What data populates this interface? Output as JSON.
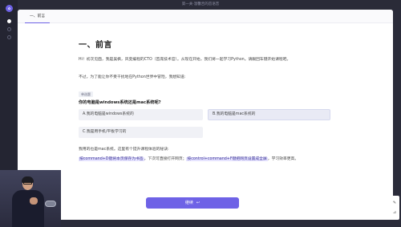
{
  "window": {
    "title": "第一关·温馨舌的首语音"
  },
  "rail": {
    "logo": "✿"
  },
  "tabs": [
    {
      "label": "一、前言"
    }
  ],
  "content": {
    "heading": "一、前言",
    "paragraph1": "Hi！初次见面，我是吴枫，风变编程的CTO（首席技术官）。从现在开始，我们将一起学习Python。请跟回车键开始课程吧。",
    "paragraph2": "不过，为了能让你不受干扰地在Python世界中冒险，我想知道:",
    "badge": "单选题",
    "question": "你的电脑是windows系统还是mac系统呢?",
    "options": [
      {
        "label": "A.我的电脑是windows系统的",
        "selected": false
      },
      {
        "label": "B.我的电脑是mac系统的",
        "selected": true
      },
      {
        "label": "C.我是用手机/平板学习的",
        "selected": false
      }
    ],
    "paragraph3": "我用的也是mac系统。这里有个提升课程体验的秘诀:",
    "tip": {
      "hl1": "按command+D键将本页保存为书签",
      "mid": "，下次可直接打开网页；",
      "hl2": "按control+command+F键把网页设置成全屏",
      "end": "，学习效率更高。"
    }
  },
  "actions": {
    "continue_label": "继续",
    "continue_icon": "↩"
  },
  "side_tools": [
    {
      "icon": "pencil-icon",
      "glyph": "✎"
    },
    {
      "icon": "pin-icon",
      "glyph": "⊿"
    }
  ]
}
